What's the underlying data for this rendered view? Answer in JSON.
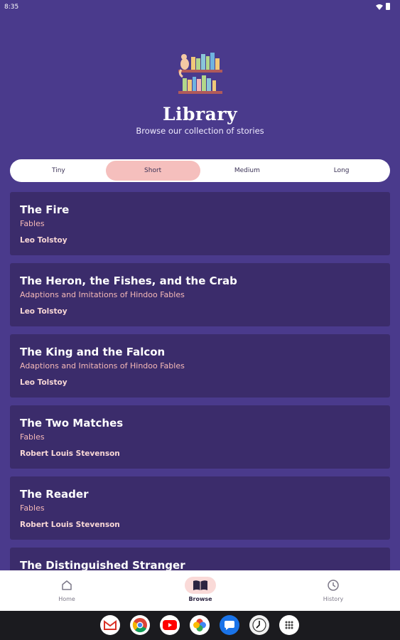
{
  "status_bar": {
    "time": "8:35"
  },
  "header": {
    "title": "Library",
    "subtitle": "Browse our collection of stories"
  },
  "segments": {
    "items": [
      "Tiny",
      "Short",
      "Medium",
      "Long"
    ],
    "selected": "Short"
  },
  "stories": [
    {
      "title": "The Fire",
      "category": "Fables",
      "author": "Leo Tolstoy"
    },
    {
      "title": "The Heron, the Fishes, and the Crab",
      "category": "Adaptions and Imitations of Hindoo Fables",
      "author": "Leo Tolstoy"
    },
    {
      "title": "The King and the Falcon",
      "category": "Adaptions and Imitations of Hindoo Fables",
      "author": "Leo Tolstoy"
    },
    {
      "title": "The Two Matches",
      "category": "Fables",
      "author": "Robert Louis Stevenson"
    },
    {
      "title": "The Reader",
      "category": "Fables",
      "author": "Robert Louis Stevenson"
    },
    {
      "title": "The Distinguished Stranger",
      "category": "",
      "author": ""
    }
  ],
  "bottom_nav": {
    "items": [
      {
        "label": "Home",
        "icon": "home-icon"
      },
      {
        "label": "Browse",
        "icon": "book-icon"
      },
      {
        "label": "History",
        "icon": "clock-icon"
      }
    ],
    "active": "Browse"
  },
  "taskbar": {
    "apps": [
      "gmail-icon",
      "chrome-icon",
      "youtube-icon",
      "photos-icon",
      "messages-icon",
      "clock-app-icon",
      "app-drawer-icon"
    ]
  },
  "colors": {
    "background": "#4a3a8c",
    "card": "#3b2c6b",
    "accent_pink": "#f5bfbd"
  }
}
